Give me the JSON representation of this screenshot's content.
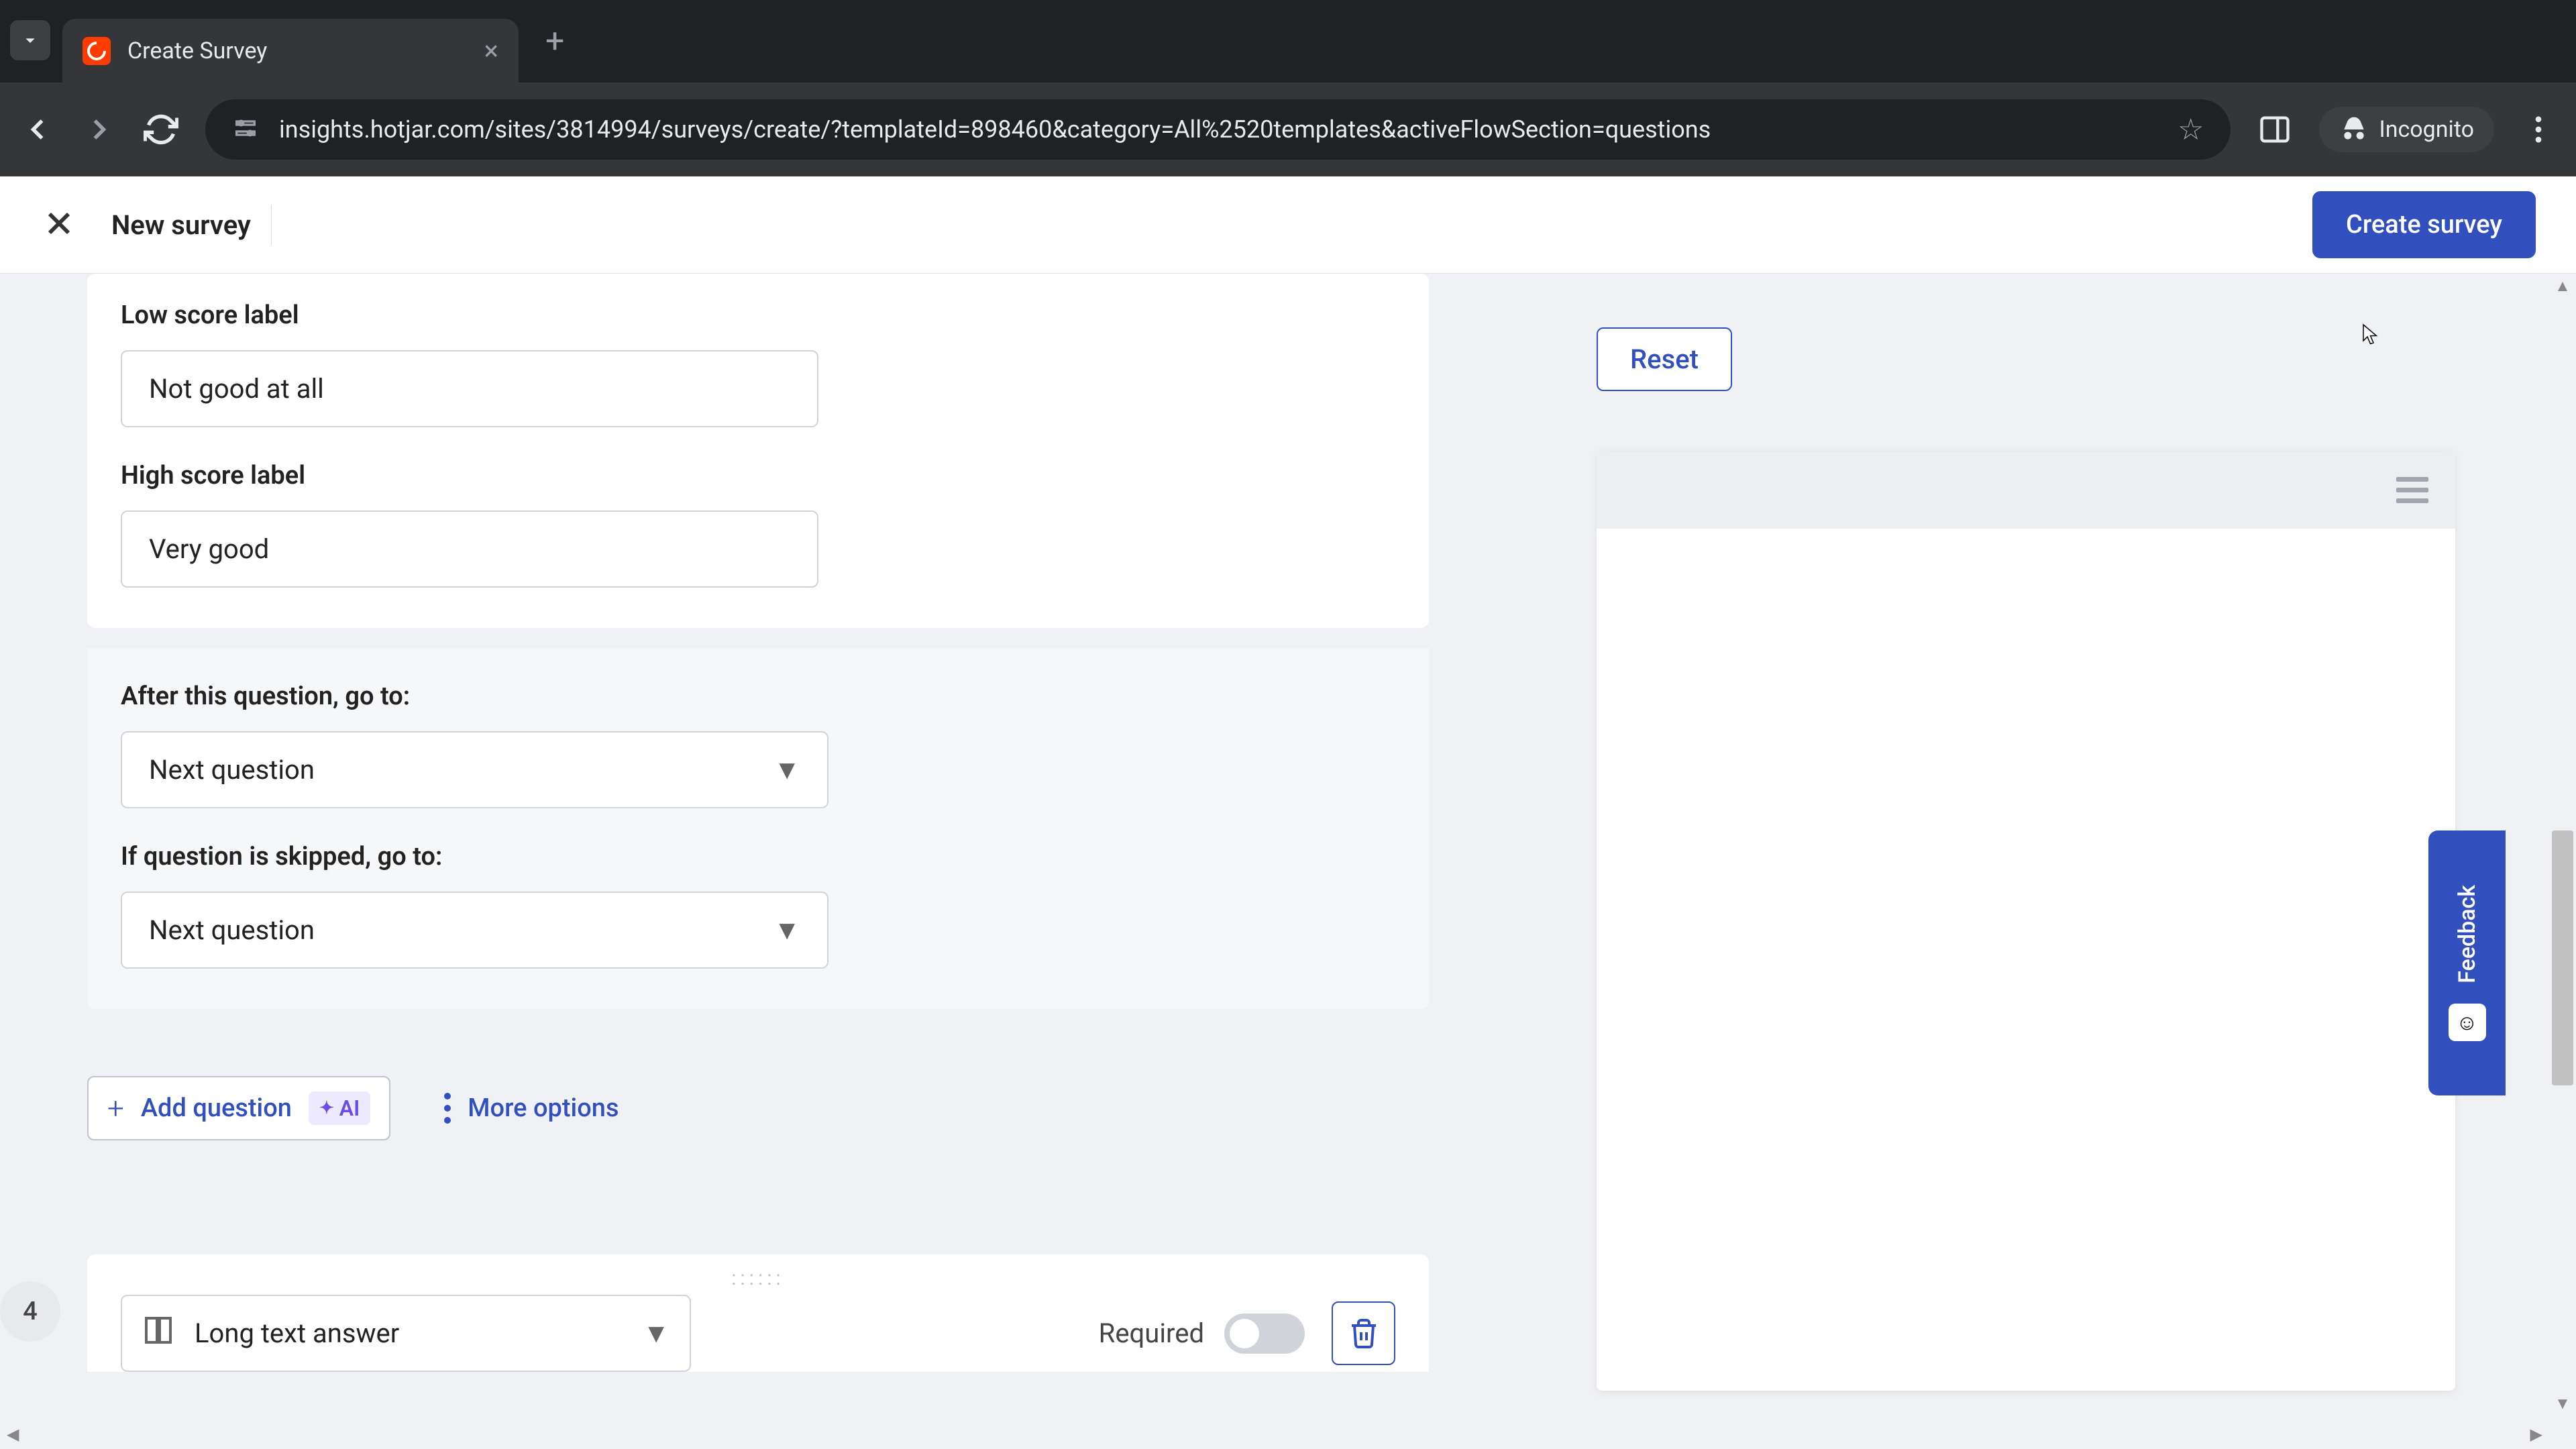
{
  "browser": {
    "tab_title": "Create Survey",
    "url": "insights.hotjar.com/sites/3814994/surveys/create/?templateId=898460&category=All%2520templates&activeFlowSection=questions",
    "incognito_label": "Incognito"
  },
  "header": {
    "title": "New survey",
    "create_button": "Create survey"
  },
  "form": {
    "low_score_label": "Low score label",
    "low_score_value": "Not good at all",
    "high_score_label": "High score label",
    "high_score_value": "Very good",
    "after_question_label": "After this question, go to:",
    "after_question_value": "Next question",
    "if_skipped_label": "If question is skipped, go to:",
    "if_skipped_value": "Next question"
  },
  "actions": {
    "add_question": "Add question",
    "ai_badge": "AI",
    "more_options": "More options"
  },
  "question4": {
    "number": "4",
    "type_label": "Long text answer",
    "required_label": "Required"
  },
  "preview": {
    "reset": "Reset"
  },
  "feedback": {
    "label": "Feedback"
  }
}
